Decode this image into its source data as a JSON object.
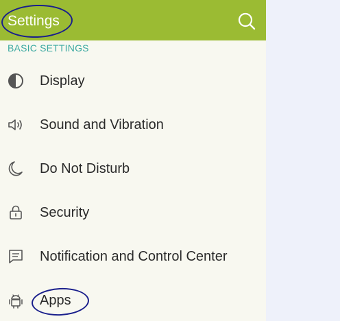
{
  "header": {
    "title": "Settings",
    "search_icon": "search-icon",
    "accent_color": "#9bbb33"
  },
  "section": {
    "label": "BASIC SETTINGS",
    "color": "#3aa8a0"
  },
  "items": [
    {
      "label": "Display",
      "icon": "display-icon"
    },
    {
      "label": "Sound and Vibration",
      "icon": "speaker-icon"
    },
    {
      "label": "Do Not Disturb",
      "icon": "moon-icon"
    },
    {
      "label": "Security",
      "icon": "lock-icon"
    },
    {
      "label": "Notification and Control Center",
      "icon": "message-icon"
    },
    {
      "label": "Apps",
      "icon": "android-icon"
    }
  ],
  "annotations": {
    "circle_color": "#1a1f8c"
  }
}
